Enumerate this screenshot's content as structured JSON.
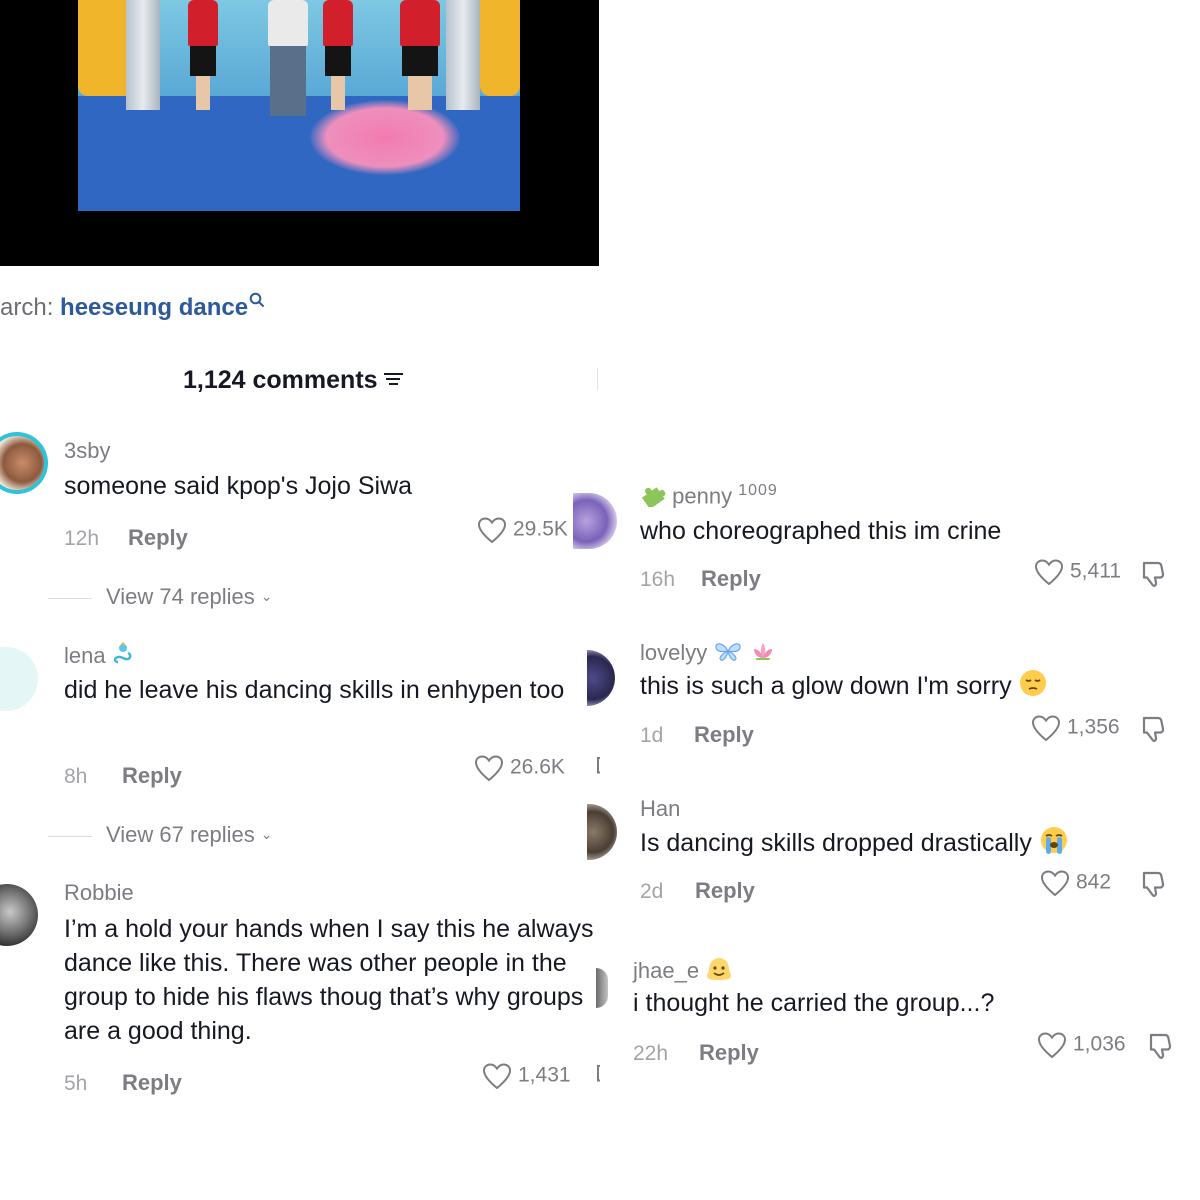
{
  "search": {
    "prefix": "arch:",
    "term": "heeseung dance"
  },
  "comments_header": {
    "count_label": "1,124 comments"
  },
  "comments_left": [
    {
      "username": "3sby",
      "text": "someone said kpop's Jojo Siwa",
      "time": "12h",
      "reply": "Reply",
      "likes": "29.5K",
      "view_replies": "View 74 replies"
    },
    {
      "username": "lena",
      "text": "did he leave his dancing skills in enhypen too",
      "time": "8h",
      "reply": "Reply",
      "likes": "26.6K",
      "view_replies": "View 67 replies"
    },
    {
      "username": "Robbie",
      "text": "I’m a hold your hands when I say this he always dance like this. There was other people in the group to hide his flaws thoug that’s why groups are a good thing.",
      "time": "5h",
      "reply": "Reply",
      "likes": "1,431"
    }
  ],
  "comments_right": [
    {
      "username": "penny",
      "username_suffix": "1009",
      "text": "who choreographed this im crine",
      "time": "16h",
      "reply": "Reply",
      "likes": "5,411"
    },
    {
      "username": "lovelyy",
      "text": "this is such a glow down I'm sorry",
      "time": "1d",
      "reply": "Reply",
      "likes": "1,356"
    },
    {
      "username": "Han",
      "text": "Is dancing skills dropped drastically",
      "time": "2d",
      "reply": "Reply",
      "likes": "842"
    },
    {
      "username": "jhae_e",
      "text": "i thought he carried the group...?",
      "time": "22h",
      "reply": "Reply",
      "likes": "1,036"
    }
  ],
  "icons": {
    "like": "heart-outline-icon",
    "dislike": "thumbs-down-icon",
    "sort": "filter-lines-icon",
    "search": "search-icon"
  },
  "colors": {
    "search_term": "#2c5a9c",
    "primary_text": "#161823",
    "secondary_text": "#7c7d82"
  }
}
